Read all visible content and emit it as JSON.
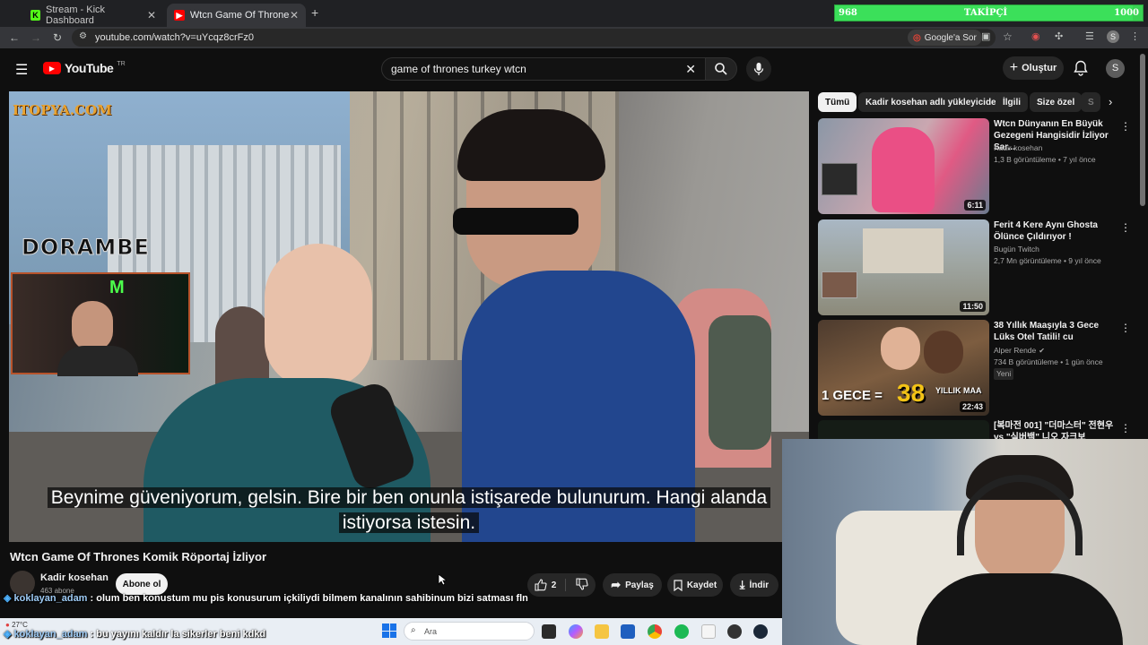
{
  "browser": {
    "tabs": [
      {
        "label": "Stream - Kick Dashboard",
        "active": false
      },
      {
        "label": "Wtcn Game Of Thrones Komik",
        "active": true
      }
    ],
    "new_tab": "+",
    "url": "youtube.com/watch?v=uYcqz8crFz0",
    "google_ask": "Google'a Sor",
    "profile_initial": "S"
  },
  "follower_overlay": {
    "current": "968",
    "label": "TAKİPÇİ",
    "goal": "1000",
    "fill_fraction": 0.968
  },
  "youtube": {
    "logo": "YouTube",
    "region": "TR",
    "search_query": "game of thrones turkey wtcn",
    "create_label": "Oluştur",
    "avatar_initial": "S"
  },
  "video": {
    "overlay_logo_top": "ITOPYA.COM",
    "overlay_logo_mid": "DORAMBE",
    "subtitle_line1": "Beynime güveniyorum, gelsin. Bire bir ben onunla istişarede bulunurum. Hangi alanda",
    "subtitle_line2": "istiyorsa istesin.",
    "title": "Wtcn Game Of Thrones Komik Röportaj İzliyor",
    "channel": "Kadir kosehan",
    "subscribers": "463 abone",
    "subscribe_label": "Abone ol",
    "like_count": "2",
    "share_label": "Paylaş",
    "save_label": "Kaydet",
    "download_label": "İndir"
  },
  "chips": [
    "Tümü",
    "Kadir kosehan adlı yükleyiciden",
    "İlgili",
    "Size özel",
    "S"
  ],
  "recommendations": [
    {
      "title": "Wtcn Dünyanın En Büyük Gezegeni Hangisidir İzliyor Sar...",
      "channel": "Kadir kosehan",
      "meta": "1,3 B görüntüleme • 7 yıl önce",
      "duration": "6:11",
      "badge": ""
    },
    {
      "title": "Ferit 4 Kere Aynı Ghosta Ölünce Çıldırıyor !",
      "channel": "Bugün Twitch",
      "meta": "2,7 Mn görüntüleme • 9 yıl önce",
      "duration": "11:50",
      "badge": ""
    },
    {
      "title": "38 Yıllık Maaşıyla 3 Gece Lüks Otel Tatili! cu",
      "channel": "Alper Rende",
      "meta": "734 B görüntüleme • 1 gün önce",
      "duration": "22:43",
      "badge": "Yeni",
      "thumb_text_a": "1 GECE =",
      "thumb_text_b": "38",
      "thumb_text_c": "YILLIK MAA"
    },
    {
      "title": "[복마전 001] \"더마스터\" 전현우 vs \"실버백\" 니오 자크보",
      "channel": "",
      "meta": "",
      "duration": "",
      "badge": ""
    }
  ],
  "chat": [
    {
      "user": "koklayan_adam",
      "message": " : olum ben konustum mu pis konusurum içkiliydi bilmem kanalının sahibinum bizi satması fln"
    },
    {
      "user": "koklayan_adam",
      "message": " : bu yayını kaldır la sikerler beni kdkd"
    }
  ],
  "taskbar": {
    "weather": "27°C",
    "search_placeholder": "Ara"
  }
}
